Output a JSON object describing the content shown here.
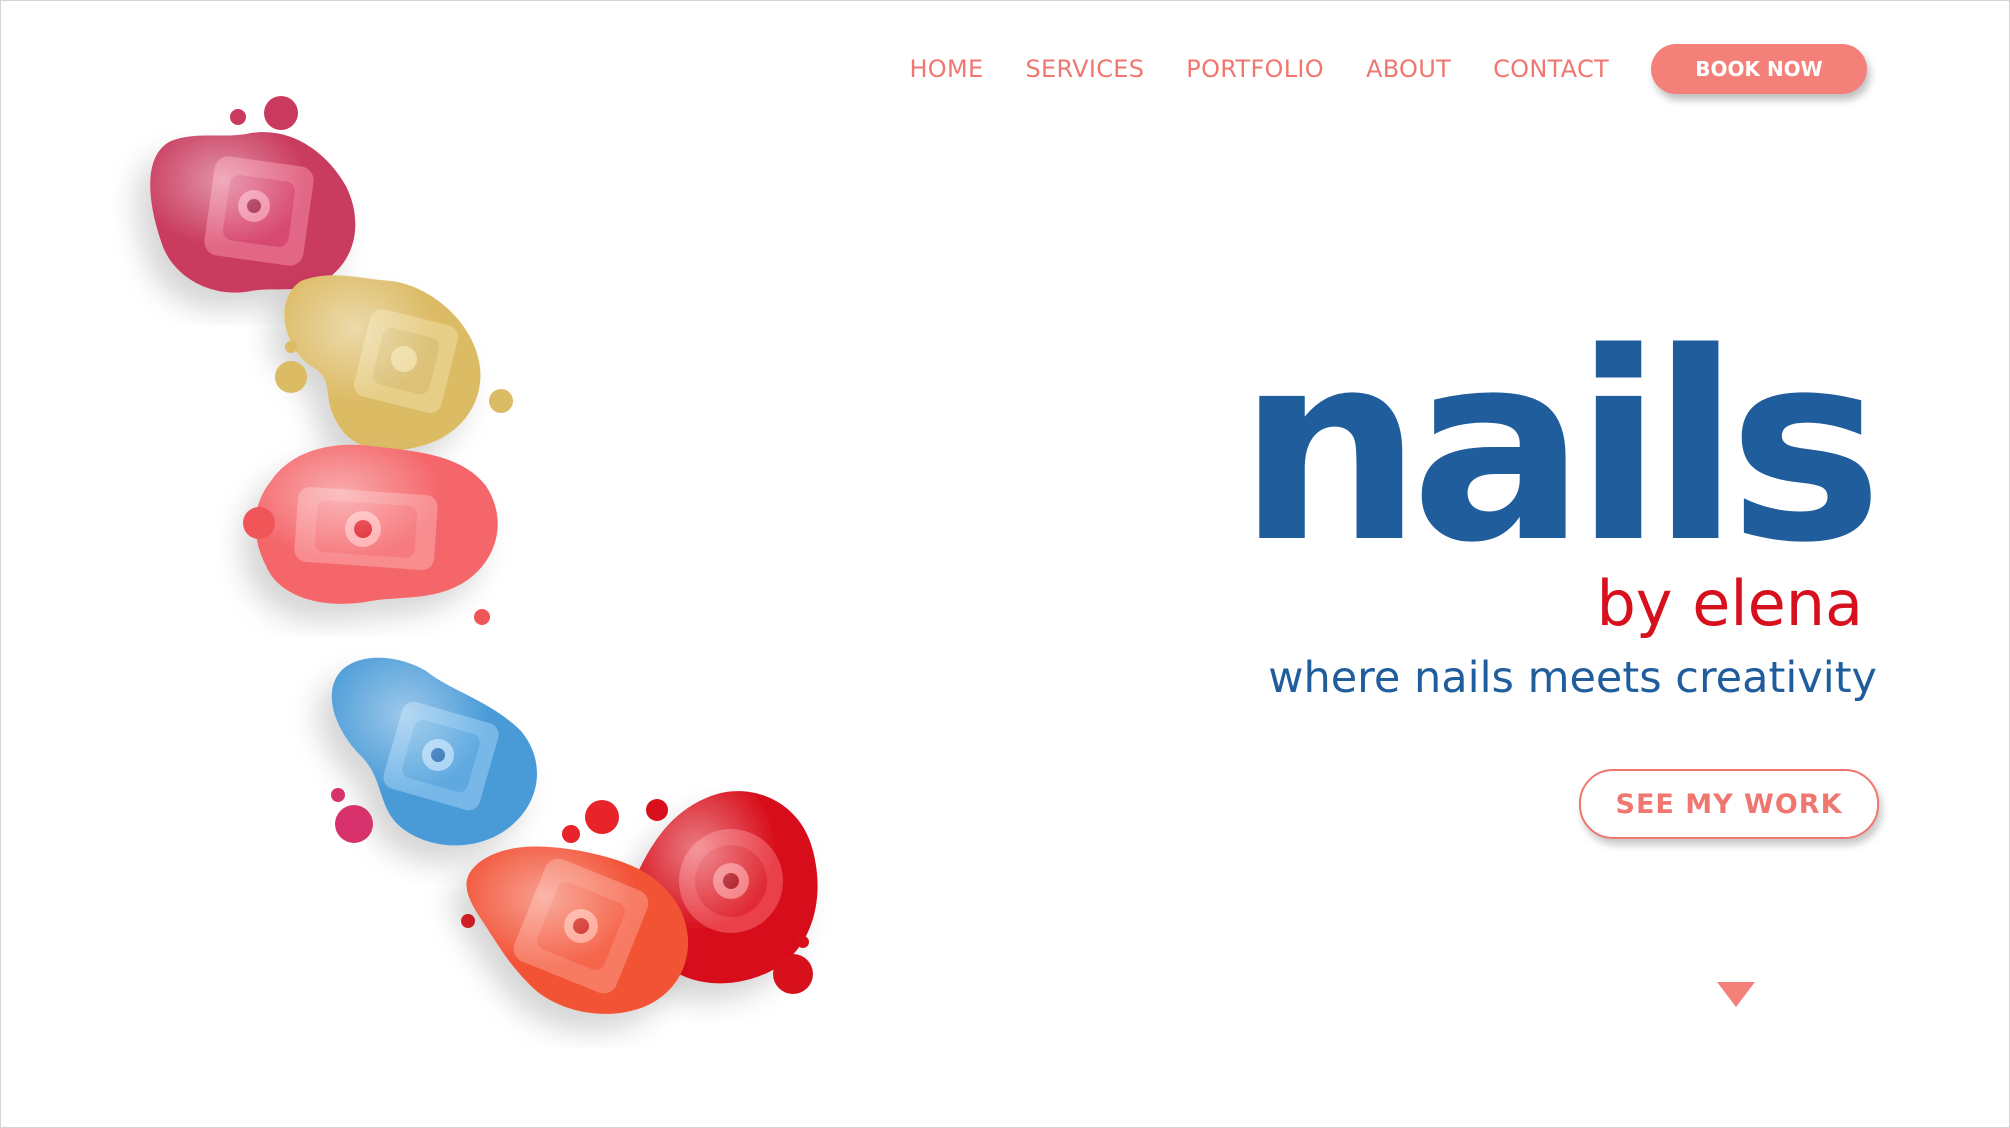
{
  "nav": {
    "items": [
      {
        "label": "HOME"
      },
      {
        "label": "SERVICES"
      },
      {
        "label": "PORTFOLIO"
      },
      {
        "label": "ABOUT"
      },
      {
        "label": "CONTACT"
      }
    ],
    "book_label": "BOOK NOW"
  },
  "hero": {
    "title": "nails",
    "byline": "by elena",
    "tagline": "where nails meets creativity",
    "cta_label": "SEE MY WORK"
  },
  "illustration": {
    "name": "nail-polish-bottles-icon",
    "polish_colors": [
      "#c93a5e",
      "#dcbb65",
      "#f4666a",
      "#4a9bd8",
      "#f25236",
      "#d8101c"
    ]
  },
  "colors": {
    "accent": "#f4807a",
    "title": "#1f5d9c",
    "byline": "#d6101c"
  }
}
